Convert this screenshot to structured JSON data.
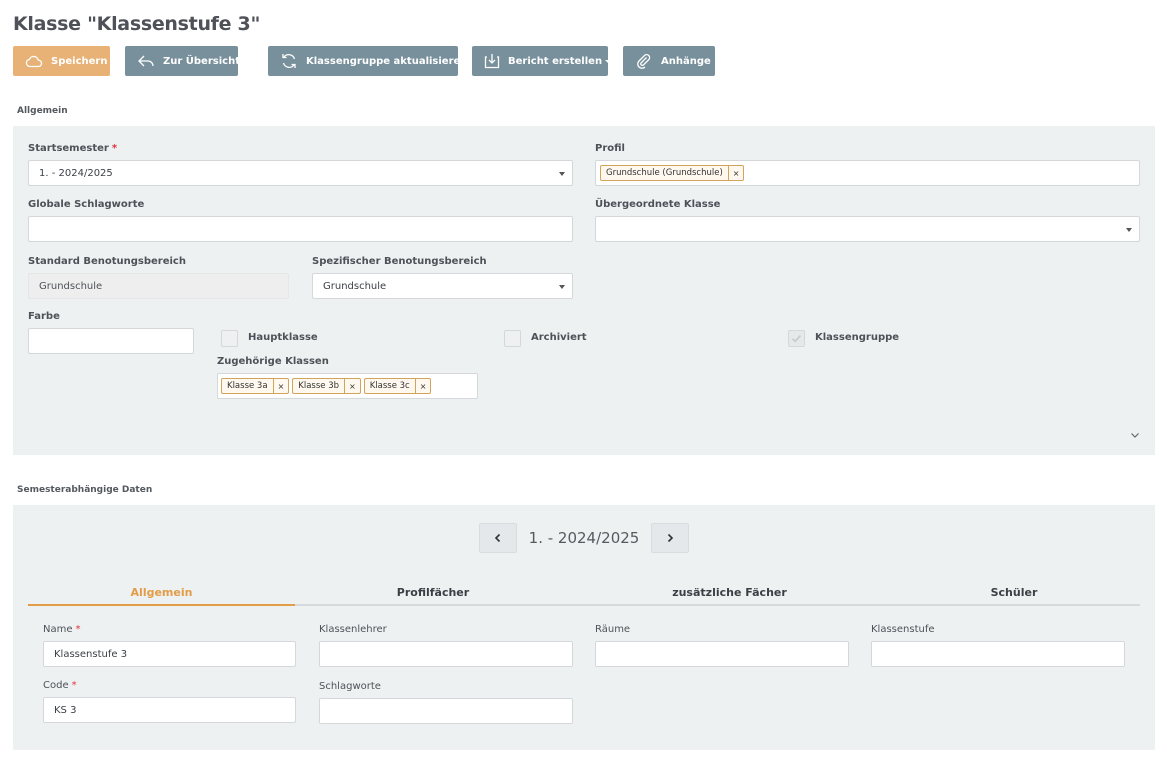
{
  "page": {
    "title": "Klasse \"Klassenstufe 3\""
  },
  "toolbar": {
    "save_label": "Speichern",
    "overview_label": "Zur Übersicht",
    "update_group_label": "Klassengruppe aktualisieren",
    "report_label": "Bericht erstellen",
    "attachments_label": "Anhänge",
    "colors": {
      "primary": "#e8b277",
      "secondary": "#78909c"
    }
  },
  "general": {
    "section_label": "Allgemein",
    "start_semester": {
      "label": "Startsemester",
      "value": "1. - 2024/2025"
    },
    "profile": {
      "label": "Profil",
      "tags": [
        "Grundschule (Grundschule)"
      ]
    },
    "global_keywords": {
      "label": "Globale Schlagworte",
      "value": ""
    },
    "parent_class": {
      "label": "Übergeordnete Klasse",
      "value": ""
    },
    "standard_grading": {
      "label": "Standard Benotungsbereich",
      "value": "Grundschule"
    },
    "specific_grading": {
      "label": "Spezifischer Benotungsbereich",
      "value": "Grundschule"
    },
    "color": {
      "label": "Farbe",
      "value": ""
    },
    "main_class": {
      "label": "Hauptklasse",
      "checked": false
    },
    "archived": {
      "label": "Archiviert",
      "checked": false
    },
    "class_group": {
      "label": "Klassengruppe",
      "checked": true
    },
    "related_classes": {
      "label": "Zugehörige Klassen",
      "tags": [
        "Klasse 3a",
        "Klasse 3b",
        "Klasse 3c"
      ]
    }
  },
  "semester": {
    "section_label": "Semesterabhängige Daten",
    "current": "1. - 2024/2025",
    "tabs": [
      {
        "label": "Allgemein",
        "active": true
      },
      {
        "label": "Profilfächer",
        "active": false
      },
      {
        "label": "zusätzliche Fächer",
        "active": false
      },
      {
        "label": "Schüler",
        "active": false
      }
    ],
    "fields": {
      "name": {
        "label": "Name",
        "value": "Klassenstufe 3"
      },
      "code": {
        "label": "Code",
        "value": "KS 3"
      },
      "teacher": {
        "label": "Klassenlehrer",
        "value": ""
      },
      "keywords": {
        "label": "Schlagworte",
        "value": ""
      },
      "rooms": {
        "label": "Räume",
        "value": ""
      },
      "level": {
        "label": "Klassenstufe",
        "value": ""
      }
    },
    "accent_color": "#e39c47"
  },
  "required_marker": "*"
}
